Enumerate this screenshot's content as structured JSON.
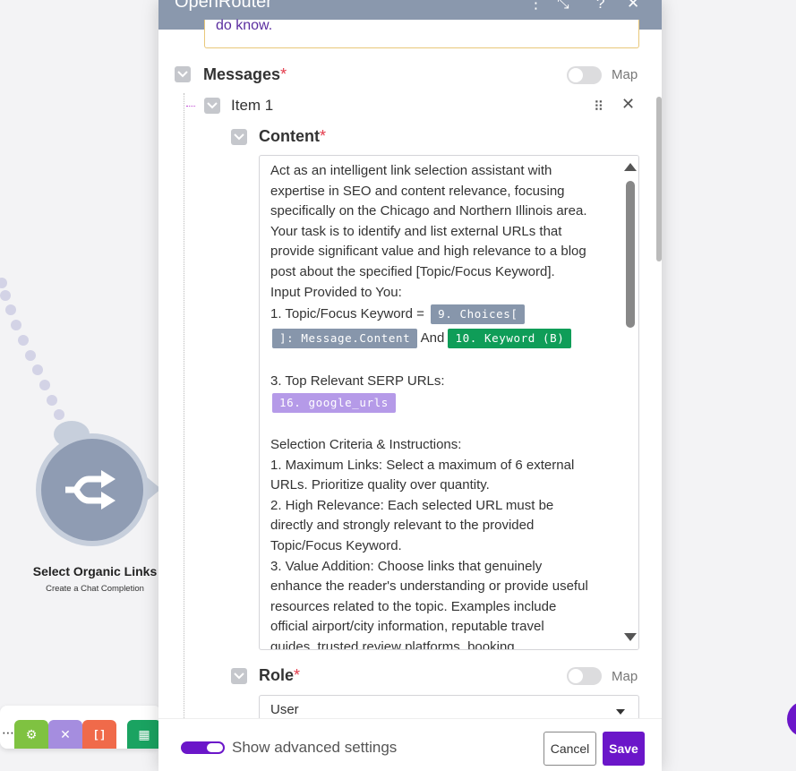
{
  "colors": {
    "accent": "#6b16c9",
    "header_bg": "#8a98ad",
    "required": "#e33b4b",
    "pill_gray": "#8796ab",
    "pill_green": "#0f9d58",
    "pill_purple": "#b59ae8"
  },
  "canvas": {
    "node_title": "Select Organic Links",
    "node_subtitle": "Create a Chat Completion",
    "node_icon": "openrouter-arrows-icon",
    "toolbar_icons": [
      "gear-icon",
      "tools-icon",
      "brackets-icon",
      "sheets-icon"
    ],
    "toolbar_bracket_text": "[ ]"
  },
  "dialog": {
    "title": "OpenRouter",
    "header_icons": [
      "more-icon",
      "expand-icon",
      "help-icon",
      "close-icon"
    ],
    "header_glyphs": {
      "more": "⋮",
      "expand": "⤡",
      "help": "?",
      "close": "✕"
    },
    "note_text": "do know."
  },
  "messages": {
    "label": "Messages",
    "required_mark": "*",
    "map_label": "Map",
    "item_label": "Item 1",
    "grip_glyph": "⠿",
    "close_glyph": "✕",
    "content": {
      "label": "Content",
      "required_mark": "*",
      "lines": [
        "Act as an intelligent link selection assistant with",
        "expertise in SEO and content relevance, focusing",
        "specifically on the Chicago and Northern Illinois area.",
        "Your task is to identify and list external URLs that",
        "provide significant value and high relevance to a blog",
        "post about the specified [Topic/Focus Keyword].",
        "Input Provided to You:"
      ],
      "topic_prefix": "1.  Topic/Focus Keyword =",
      "pill_choices_a": "9. Choices[",
      "pill_choices_b": "]: Message.Content",
      "and_text": "And",
      "pill_keyword": "10. Keyword (B)",
      "serp_line": "3.  Top Relevant SERP URLs:",
      "pill_urls": "16. google_urls",
      "criteria_lines": [
        "Selection Criteria & Instructions:",
        "1.  Maximum Links: Select a maximum of 6 external",
        "URLs. Prioritize quality over quantity.",
        "2.  High Relevance: Each selected URL must be",
        "directly and strongly relevant to the provided",
        "Topic/Focus Keyword.",
        "3.  Value Addition: Choose links that genuinely",
        "enhance the reader's understanding or provide useful",
        "resources related to the topic. Examples include",
        "official airport/city information, reputable travel",
        "guides, trusted review platforms, booking"
      ]
    },
    "role": {
      "label": "Role",
      "required_mark": "*",
      "map_label": "Map",
      "value": "User"
    }
  },
  "footer": {
    "advanced_label": "Show advanced settings",
    "advanced_on": true,
    "cancel_label": "Cancel",
    "save_label": "Save"
  }
}
